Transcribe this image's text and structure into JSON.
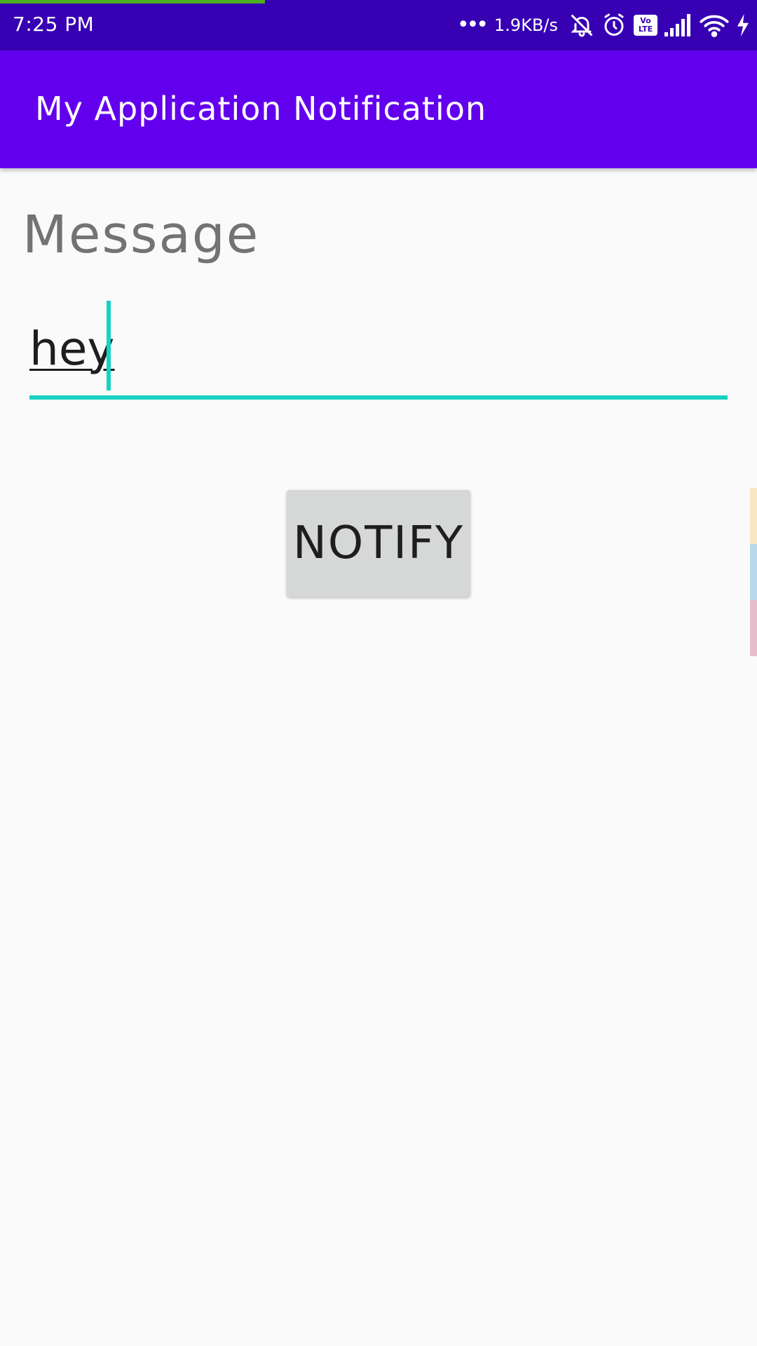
{
  "status_bar": {
    "time": "7:25 PM",
    "dots": "•••",
    "network_speed": "1.9KB/s",
    "volte_top": "Vo",
    "volte_bottom": "LTE",
    "icons": [
      "bell-muted-icon",
      "alarm-icon",
      "volte-icon",
      "signal-icon",
      "wifi-icon",
      "charging-icon"
    ]
  },
  "app_bar": {
    "title": "My Application Notification",
    "color": "#6200ee"
  },
  "form": {
    "label": "Message",
    "input_value": "hey",
    "accent_color": "#17d1c2"
  },
  "actions": {
    "notify_label": "NOTIFY"
  },
  "edge_tabs": {
    "colors": [
      "#f9e7c3",
      "#b9d8ec",
      "#e7bccb"
    ]
  }
}
